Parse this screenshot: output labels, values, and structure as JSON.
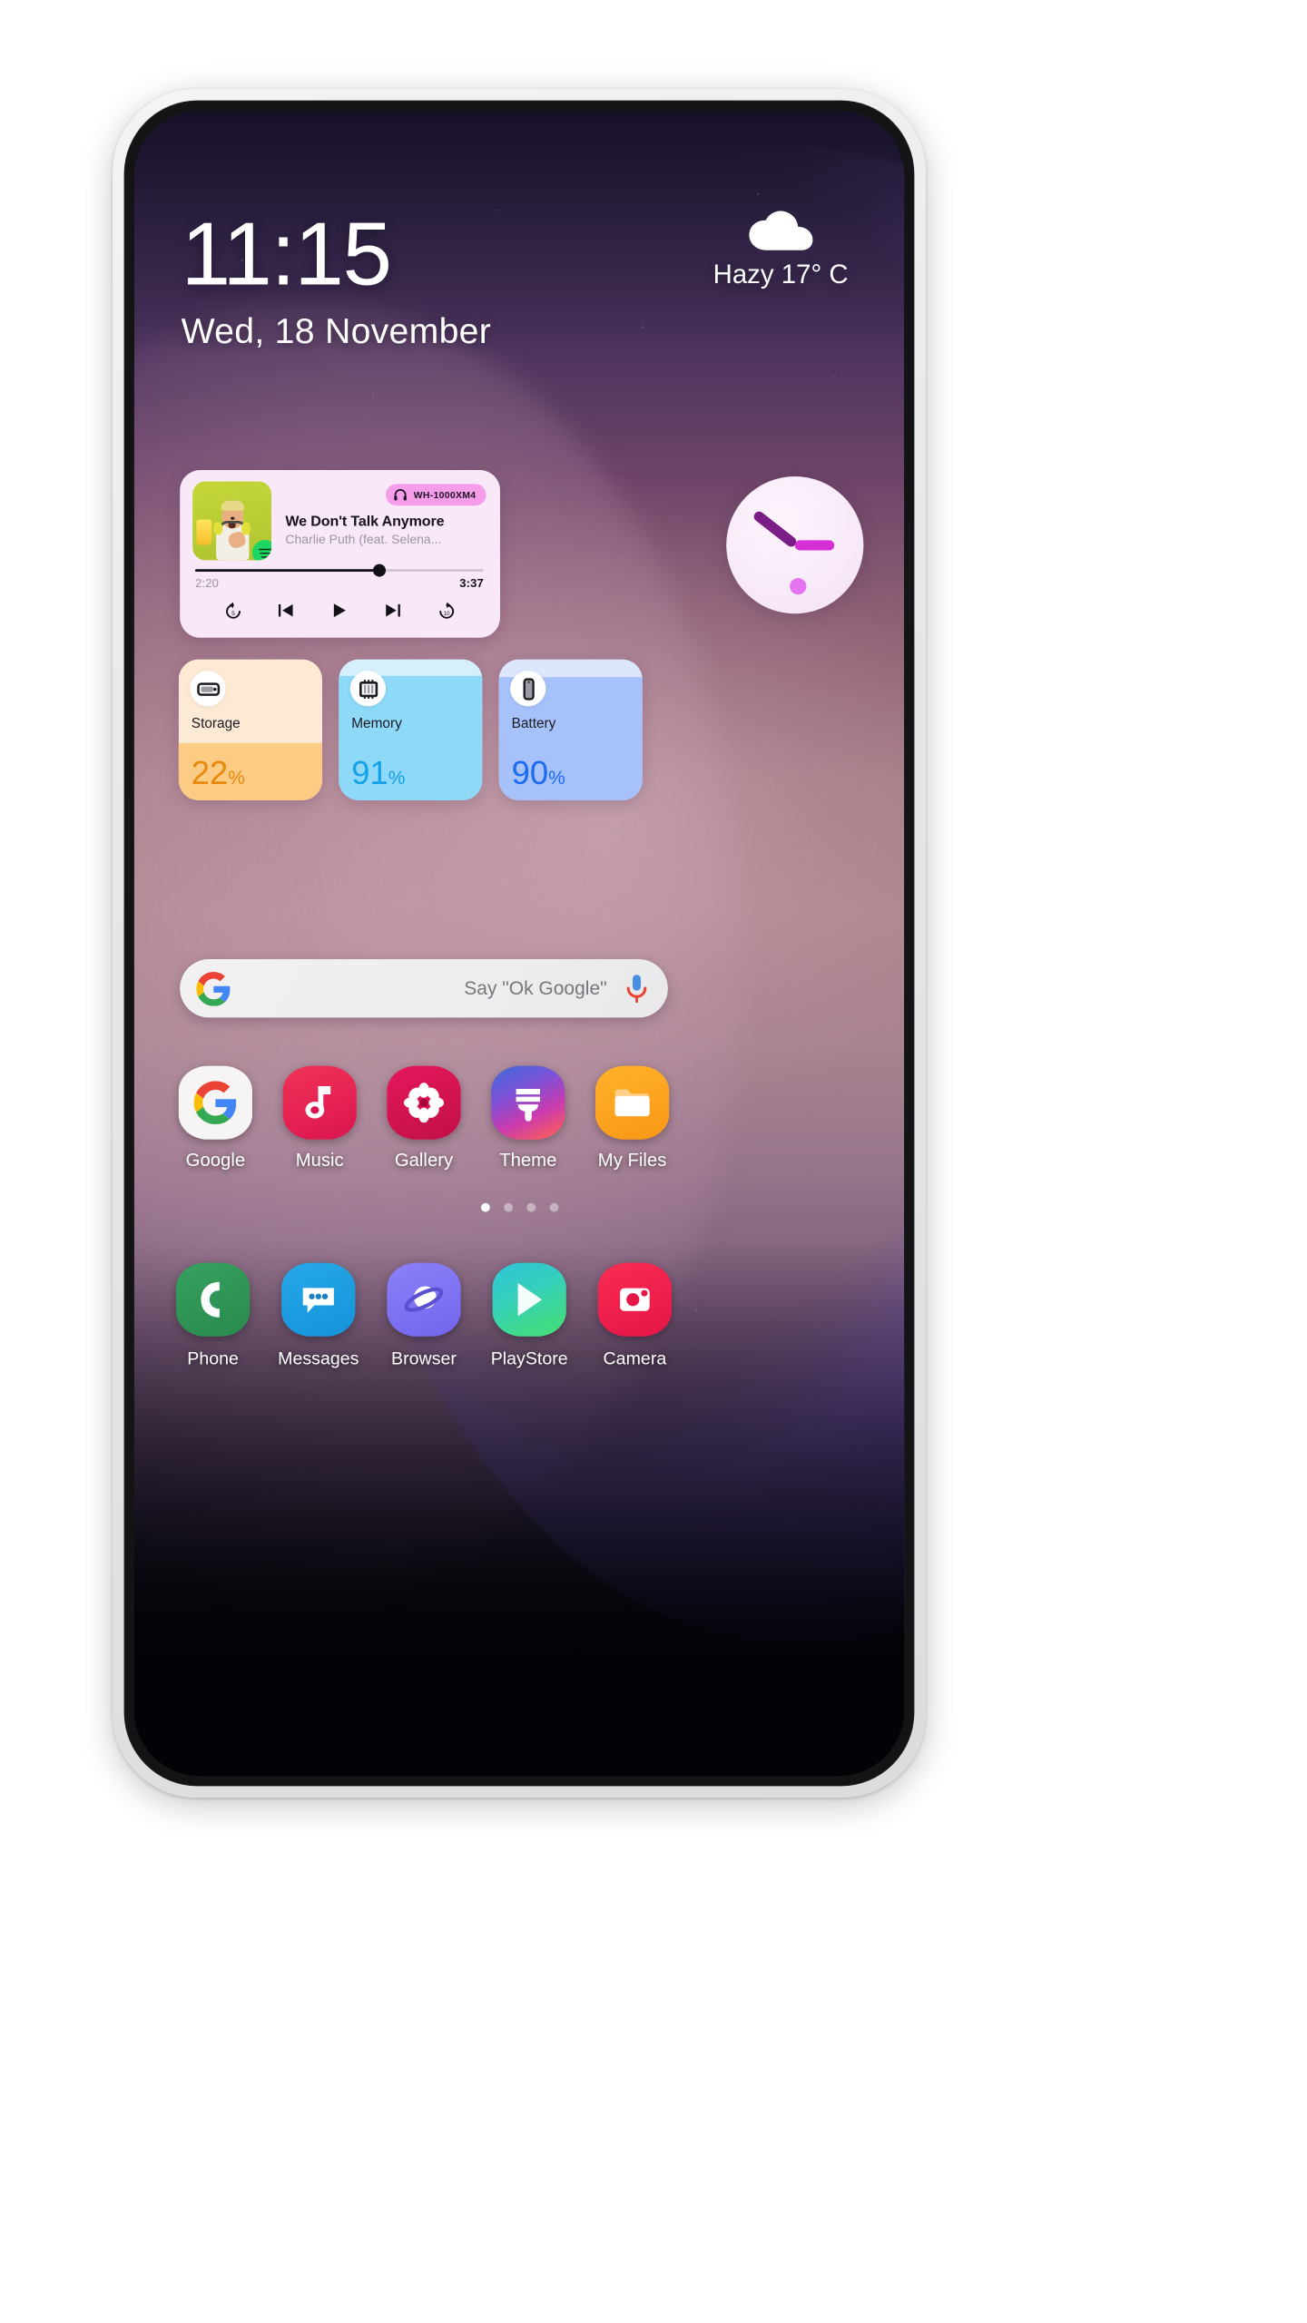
{
  "status": {
    "time": "11:15",
    "date": "Wed, 18 November",
    "weather_text": "Hazy 17° C",
    "weather_icon": "cloud-icon"
  },
  "music_widget": {
    "device_badge": "WH-1000XM4",
    "device_icon": "headphones-icon",
    "track_title": "We Don't Talk Anymore",
    "track_artist": "Charlie Puth (feat. Selena...",
    "source_icon": "spotify-icon",
    "current_time": "2:20",
    "total_time": "3:37",
    "progress_percent": 64,
    "controls": [
      {
        "name": "rewind-5-icon",
        "label": "5"
      },
      {
        "name": "previous-track-icon",
        "label": ""
      },
      {
        "name": "play-icon",
        "label": ""
      },
      {
        "name": "next-track-icon",
        "label": ""
      },
      {
        "name": "forward-10-icon",
        "label": "10"
      }
    ]
  },
  "clock_widget": {
    "hour_angle": -52,
    "minute_angle": 90,
    "hour_hand_color": "#7a1d86",
    "minute_hand_color": "#d62fd6",
    "dot_color": "#e574f0",
    "face_color": "#f8eaf8"
  },
  "stats": [
    {
      "label": "Storage",
      "value": "22",
      "unit": "%",
      "fill_percent": 22,
      "icon": "storage-icon",
      "accent": "#e8890d"
    },
    {
      "label": "Memory",
      "value": "91",
      "unit": "%",
      "fill_percent": 91,
      "icon": "memory-chip-icon",
      "accent": "#14a1e8"
    },
    {
      "label": "Battery",
      "value": "90",
      "unit": "%",
      "fill_percent": 90,
      "icon": "phone-battery-icon",
      "accent": "#1a6bf0"
    }
  ],
  "search": {
    "placeholder": "Say \"Ok Google\"",
    "left_icon": "google-logo-icon",
    "right_icon": "microphone-icon"
  },
  "apps": [
    {
      "label": "Google",
      "icon": "google-app-icon"
    },
    {
      "label": "Music",
      "icon": "music-note-icon"
    },
    {
      "label": "Gallery",
      "icon": "gallery-flower-icon"
    },
    {
      "label": "Theme",
      "icon": "theme-brush-icon"
    },
    {
      "label": "My Files",
      "icon": "folder-icon"
    }
  ],
  "page_dots": {
    "total": 4,
    "active_index": 0
  },
  "dock": [
    {
      "label": "Phone",
      "icon": "phone-handset-icon"
    },
    {
      "label": "Messages",
      "icon": "message-bubble-icon"
    },
    {
      "label": "Browser",
      "icon": "browser-planet-icon"
    },
    {
      "label": "PlayStore",
      "icon": "play-triangle-icon"
    },
    {
      "label": "Camera",
      "icon": "camera-icon"
    }
  ]
}
